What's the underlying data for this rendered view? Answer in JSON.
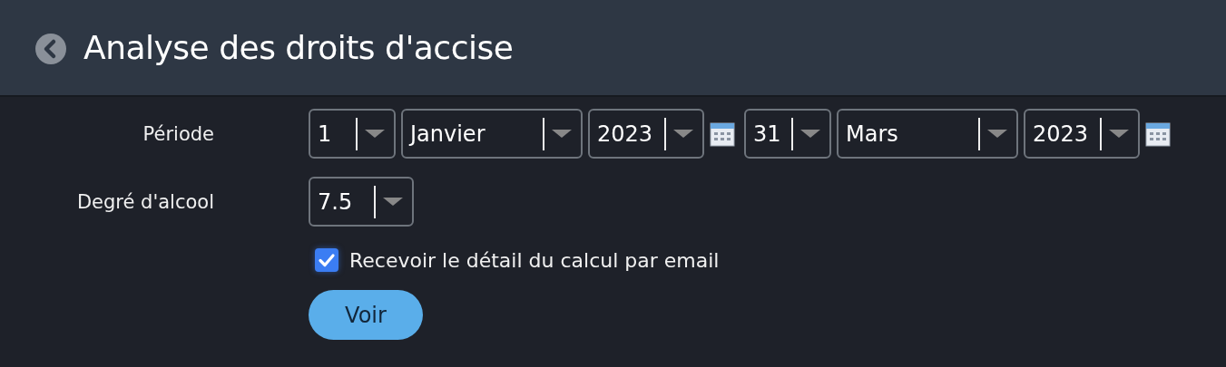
{
  "header": {
    "title": "Analyse des droits d'accise"
  },
  "period": {
    "label": "Période",
    "groups": [
      {
        "selects": [
          {
            "value": "1",
            "kind": "day"
          },
          {
            "value": "Janvier",
            "kind": "month"
          },
          {
            "value": "2023",
            "kind": "year"
          }
        ]
      },
      {
        "selects": [
          {
            "value": "31",
            "kind": "day"
          },
          {
            "value": "Mars",
            "kind": "month"
          },
          {
            "value": "2023",
            "kind": "year"
          }
        ]
      }
    ]
  },
  "alcohol": {
    "label": "Degré d'alcool",
    "value": "7.5"
  },
  "email_option": {
    "label": "Recevoir le détail du calcul par email",
    "checked": true
  },
  "submit": {
    "label": "Voir"
  }
}
